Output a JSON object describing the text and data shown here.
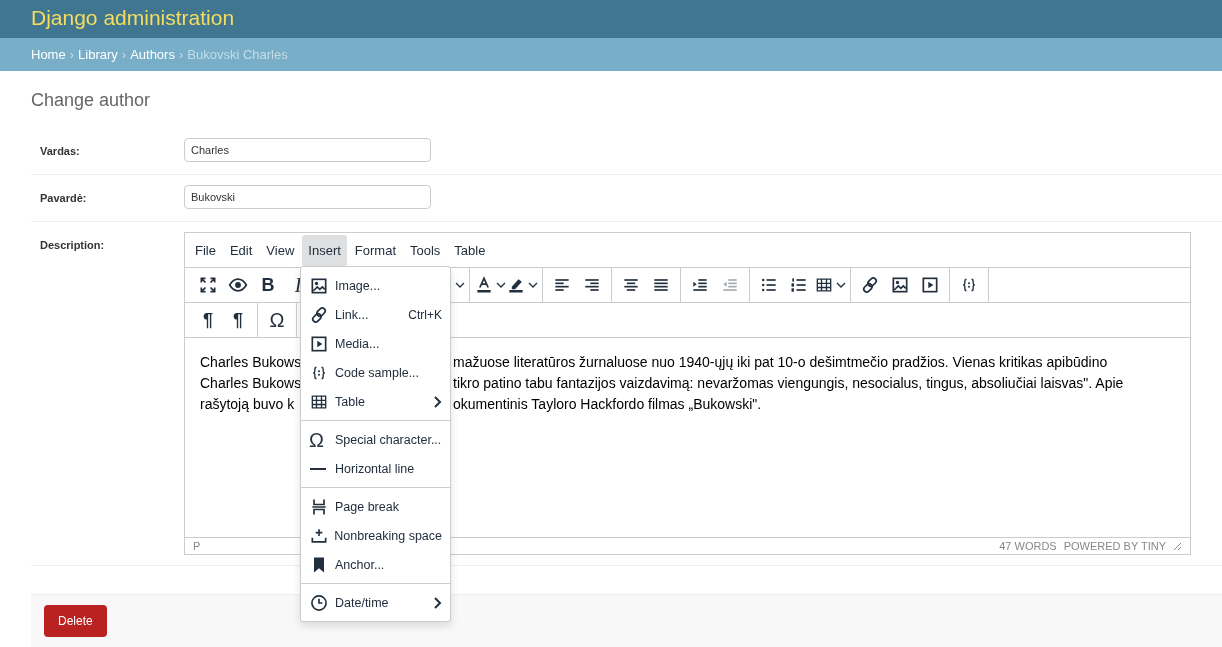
{
  "header": {
    "title": "Django administration"
  },
  "breadcrumbs": {
    "separator": "›",
    "items": [
      {
        "label": "Home",
        "kind": "link"
      },
      {
        "label": "Library",
        "kind": "link"
      },
      {
        "label": "Authors",
        "kind": "link"
      },
      {
        "label": "Bukovski Charles",
        "kind": "current"
      }
    ]
  },
  "page_title": "Change author",
  "fields": [
    {
      "label": "Vardas:",
      "value": "Charles"
    },
    {
      "label": "Pavardė:",
      "value": "Bukovski"
    }
  ],
  "description": {
    "label": "Description:",
    "editor": {
      "menubar": [
        {
          "label": "File",
          "selected": false
        },
        {
          "label": "Edit",
          "selected": false
        },
        {
          "label": "View",
          "selected": false
        },
        {
          "label": "Insert",
          "selected": true
        },
        {
          "label": "Format",
          "selected": false
        },
        {
          "label": "Tools",
          "selected": false
        },
        {
          "label": "Table",
          "selected": false
        }
      ],
      "toolbar_rows": [
        [
          [
            {
              "dropdown": false,
              "disabled": false
            },
            {
              "dropdown": false,
              "disabled": false
            },
            {
              "glyph": "B",
              "dropdown": false,
              "disabled": false
            },
            {
              "glyph": "I",
              "dropdown": false,
              "disabled": false
            },
            {
              "dropdown": true,
              "disabled": false
            }
          ],
          [
            {
              "dropdown": true,
              "disabled": false
            },
            {
              "dropdown": true,
              "disabled": false
            }
          ],
          [
            {
              "dropdown": false,
              "disabled": false
            },
            {
              "dropdown": false,
              "disabled": false
            }
          ],
          [
            {
              "dropdown": false,
              "disabled": false
            },
            {
              "dropdown": false,
              "disabled": false
            }
          ],
          [
            {
              "dropdown": false,
              "disabled": false
            },
            {
              "dropdown": false,
              "disabled": true
            }
          ],
          [
            {
              "dropdown": false,
              "disabled": false
            },
            {
              "dropdown": false,
              "disabled": false
            },
            {
              "dropdown": true,
              "disabled": false
            }
          ],
          [
            {
              "dropdown": false,
              "disabled": false
            },
            {
              "dropdown": false,
              "disabled": false
            },
            {
              "dropdown": false,
              "disabled": false
            }
          ],
          [
            {
              "dropdown": false,
              "disabled": false
            }
          ]
        ],
        [
          [
            {
              "glyph": "¶",
              "dropdown": false,
              "disabled": false
            },
            {
              "glyph": "¶",
              "dropdown": false,
              "disabled": false
            }
          ],
          [
            {
              "glyph": "Ω",
              "dropdown": false,
              "disabled": false
            }
          ]
        ]
      ],
      "content_lines": [
        {
          "left": "Charles Bukows",
          "right": "mažuose literatūros žurnaluose nuo 1940-ųjų iki pat 10-o dešimtmečio pradžios. Vienas kritikas apibūdino"
        },
        {
          "left": "Charles Bukows",
          "right": "tikro patino tabu fantazijos vaizdavimą: nevaržomas viengungis, nesocialus, tingus, absoliučiai laisvas\". Apie"
        },
        {
          "left": "rašytoją buvo k",
          "right": "okumentinis Tayloro Hackfordo filmas „Bukowski\"."
        }
      ],
      "status": {
        "path": "P",
        "word_count": "47 WORDS",
        "branding": "POWERED BY TINY"
      },
      "insert_menu": [
        {
          "kind": "item",
          "label": "Image...",
          "submenu": false
        },
        {
          "kind": "item",
          "label": "Link...",
          "shortcut": "Ctrl+K",
          "submenu": false
        },
        {
          "kind": "item",
          "label": "Media...",
          "submenu": false
        },
        {
          "kind": "item",
          "label": "Code sample...",
          "submenu": false
        },
        {
          "kind": "item",
          "label": "Table",
          "submenu": true
        },
        {
          "kind": "separator"
        },
        {
          "kind": "item",
          "glyph": "Ω",
          "label": "Special character...",
          "submenu": false
        },
        {
          "kind": "item",
          "label": "Horizontal line",
          "submenu": false
        },
        {
          "kind": "separator"
        },
        {
          "kind": "item",
          "label": "Page break",
          "submenu": false
        },
        {
          "kind": "item",
          "label": "Nonbreaking space",
          "submenu": false
        },
        {
          "kind": "item",
          "label": "Anchor...",
          "submenu": false
        },
        {
          "kind": "separator"
        },
        {
          "kind": "item",
          "label": "Date/time",
          "submenu": true
        }
      ]
    }
  },
  "delete_button": "Delete"
}
